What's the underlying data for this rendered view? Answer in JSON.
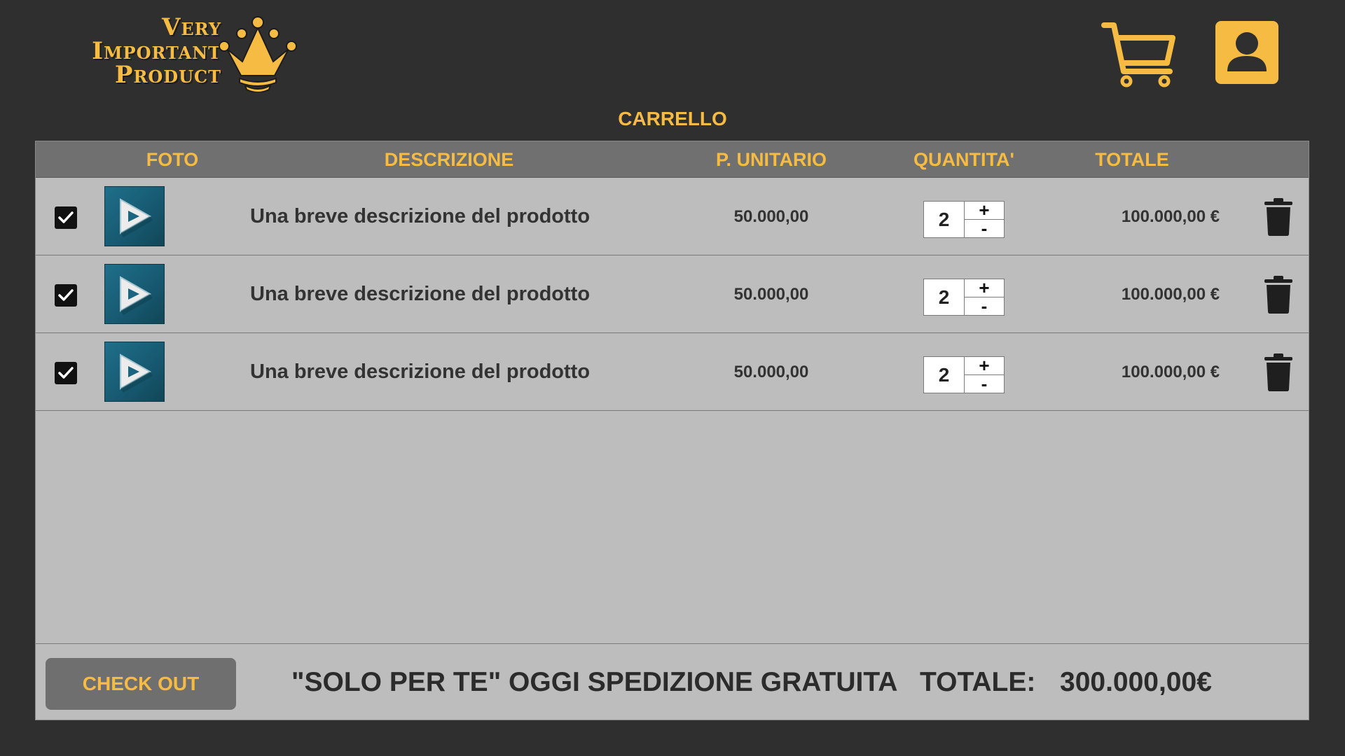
{
  "brand": {
    "logo_lines": [
      "Very",
      "Important",
      "Product"
    ],
    "logo_icon": "crown-icon",
    "accent_color": "#f6bb42",
    "background_color": "#2f2f2f"
  },
  "header": {
    "cart_icon": "shopping-cart-icon",
    "user_icon": "user-icon"
  },
  "page": {
    "title": "CARRELLO"
  },
  "table": {
    "headers": {
      "foto": "FOTO",
      "descrizione": "DESCRIZIONE",
      "prezzo_unitario": "P. UNITARIO",
      "quantita": "QUANTITA'",
      "totale": "TOTALE"
    },
    "rows": [
      {
        "checked": true,
        "photo_icon": "product-thumbnail",
        "description": "Una breve descrizione del prodotto",
        "unit_price": "50.000,00",
        "quantity": "2",
        "total": "100.000,00 €"
      },
      {
        "checked": true,
        "photo_icon": "product-thumbnail",
        "description": "Una breve descrizione del prodotto",
        "unit_price": "50.000,00",
        "quantity": "2",
        "total": "100.000,00 €"
      },
      {
        "checked": true,
        "photo_icon": "product-thumbnail",
        "description": "Una breve descrizione del prodotto",
        "unit_price": "50.000,00",
        "quantity": "2",
        "total": "100.000,00 €"
      }
    ],
    "quantity_controls": {
      "plus": "+",
      "minus": "-"
    },
    "row_delete_icon": "trash-icon"
  },
  "footer": {
    "checkout_label": "CHECK OUT",
    "promo_text": "\"SOLO PER TE\" OGGI SPEDIZIONE GRATUITA",
    "total_label": "TOTALE:",
    "grand_total": "300.000,00€"
  }
}
